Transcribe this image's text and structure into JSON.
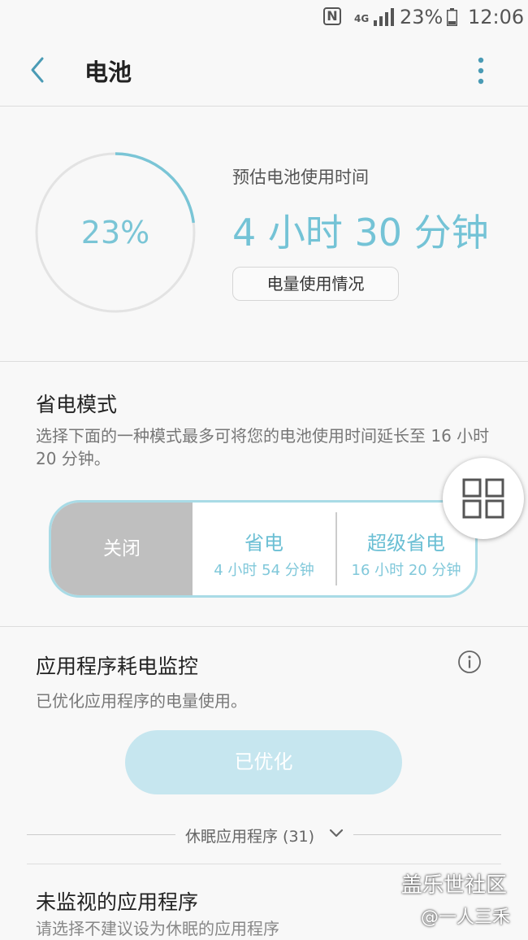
{
  "status_bar": {
    "nfc": "N",
    "network": "4G",
    "battery_percent": "23%",
    "time": "12:06"
  },
  "header": {
    "title": "电池"
  },
  "battery": {
    "level": 0.23,
    "percent_text": "23%",
    "estimate_label": "预估电池使用时间",
    "estimate_time": "4 小时 30 分钟",
    "usage_button": "电量使用情况"
  },
  "power_saving": {
    "title": "省电模式",
    "description": "选择下面的一种模式最多可将您的电池使用时间延长至 16 小时 20 分钟。",
    "modes": [
      {
        "name": "关闭",
        "time": ""
      },
      {
        "name": "省电",
        "time": "4 小时 54 分钟"
      },
      {
        "name": "超级省电",
        "time": "16 小时 20 分钟"
      }
    ]
  },
  "app_monitor": {
    "title": "应用程序耗电监控",
    "description": "已优化应用程序的电量使用。",
    "optimize_button": "已优化",
    "sleeping_apps": "休眠应用程序 (31)"
  },
  "unmonitored": {
    "title": "未监视的应用程序",
    "description": "请选择不建议设为休眠的应用程序"
  },
  "watermark": {
    "line1": "盖乐世社区",
    "line2": "@一人三禾"
  },
  "colors": {
    "accent": "#74c3d6",
    "off_mode": "#bfbfbf",
    "optimize_button": "#c6e6ef"
  }
}
